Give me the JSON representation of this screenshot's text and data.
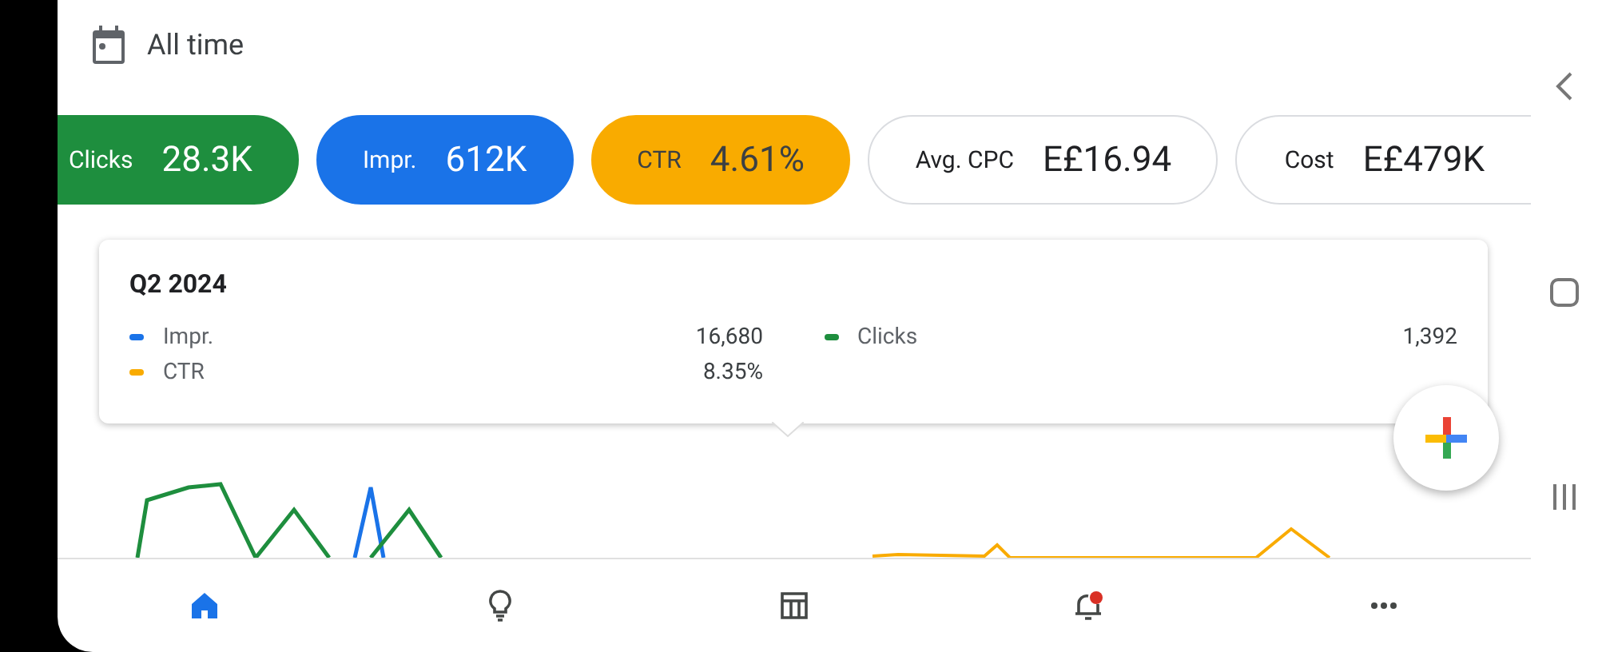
{
  "date_range": {
    "label": "All time"
  },
  "metric_chips": [
    {
      "label": "Clicks",
      "value": "28.3K",
      "selected": true,
      "color": "#1e8e3e"
    },
    {
      "label": "Impr.",
      "value": "612K",
      "selected": true,
      "color": "#1a73e8"
    },
    {
      "label": "CTR",
      "value": "4.61%",
      "selected": true,
      "color": "#f9ab00"
    },
    {
      "label": "Avg. CPC",
      "value": "E£16.94",
      "selected": false
    },
    {
      "label": "Cost",
      "value": "E£479K",
      "selected": false
    }
  ],
  "tooltip": {
    "title": "Q2 2024",
    "series": [
      {
        "label": "Impr.",
        "value": "16,680",
        "color": "#1a73e8"
      },
      {
        "label": "Clicks",
        "value": "1,392",
        "color": "#1e8e3e"
      },
      {
        "label": "CTR",
        "value": "8.35%",
        "color": "#f9ab00"
      }
    ]
  },
  "bottom_nav": [
    {
      "kind": "home",
      "selected": true
    },
    {
      "kind": "bulb",
      "selected": false
    },
    {
      "kind": "table",
      "selected": false
    },
    {
      "kind": "bell",
      "selected": false,
      "badge": true
    },
    {
      "kind": "more",
      "selected": false
    }
  ]
}
